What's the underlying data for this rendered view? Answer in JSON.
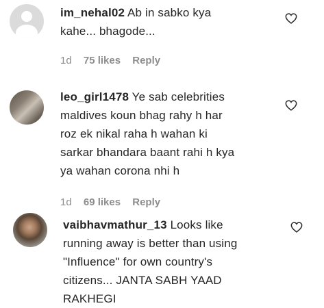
{
  "comments": [
    {
      "username": "im_nehal02",
      "text_lines": [
        "Ab in sabko kya",
        "kahe... bhagode..."
      ],
      "time": "1d",
      "likes": "75 likes",
      "reply": "Reply"
    },
    {
      "username": "leo_girl1478",
      "text_lines": [
        "Ye sab celebrities",
        "maldives koun bhag rahy h har",
        "roz ek nikal raha h wahan ki",
        "sarkar bhandara baant rahi h kya",
        "ya wahan corona nhi h"
      ],
      "time": "1d",
      "likes": "69 likes",
      "reply": "Reply"
    },
    {
      "username": "vaibhavmathur_13",
      "text_lines": [
        "Looks like",
        "running away is better than using",
        "\"Influence\" for own country's",
        "citizens... JANTA SABH YAAD",
        "RAKHEGI"
      ]
    }
  ]
}
